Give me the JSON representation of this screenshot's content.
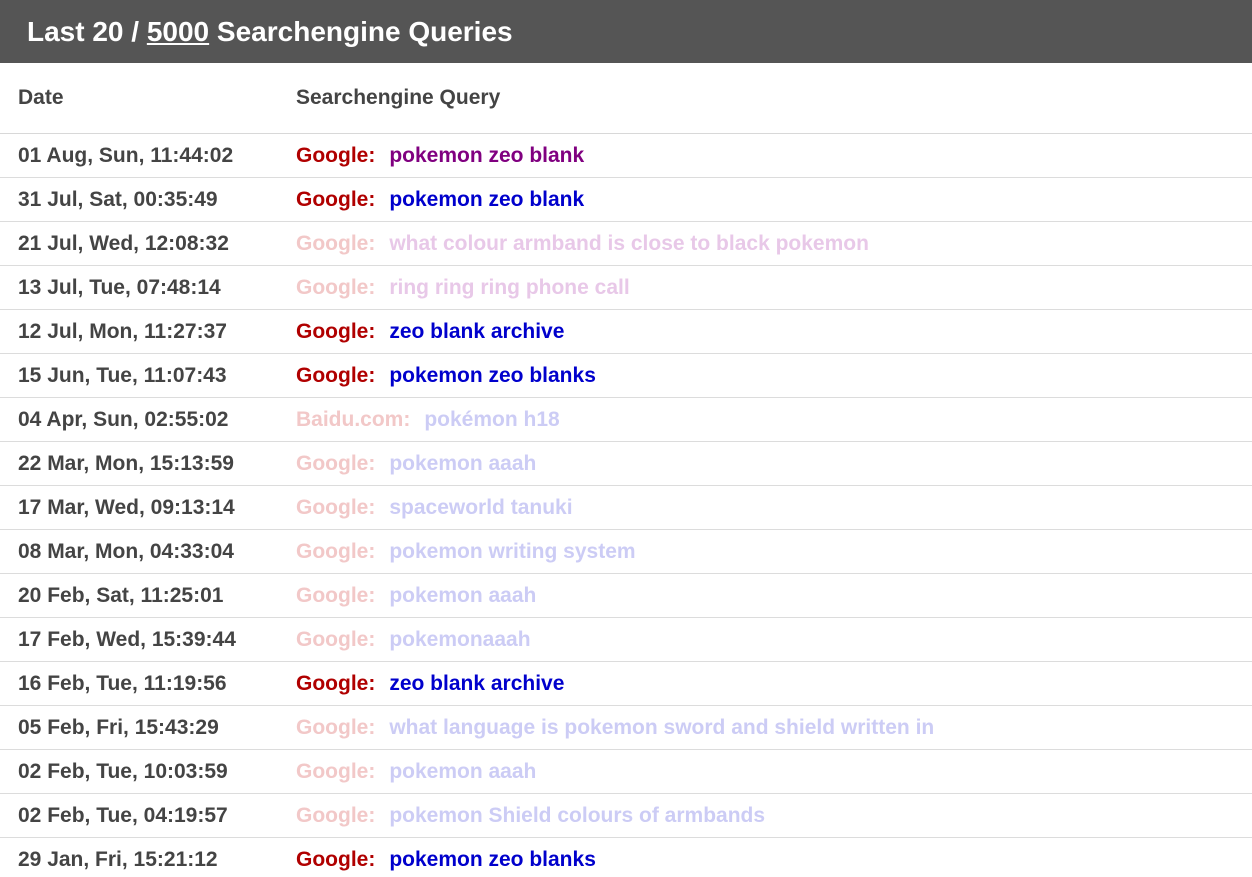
{
  "header": {
    "prefix": "Last 20 / ",
    "total": "5000",
    "suffix": " Searchengine Queries"
  },
  "columns": {
    "date": "Date",
    "query": "Searchengine Query"
  },
  "colors": {
    "header_bg": "#555555",
    "engine_active": "#b00000",
    "engine_faded": "#f2c8c8",
    "query_visited": "#800080",
    "query_active": "#0000cc",
    "query_faded_pink": "#e8c8e8",
    "query_faded_blue": "#ccccf5"
  },
  "rows": [
    {
      "date": "01 Aug, Sun, 11:44:02",
      "engine": "Google:",
      "query": "pokemon zeo blank",
      "engine_color": "#b00000",
      "query_color": "#800080"
    },
    {
      "date": "31 Jul, Sat, 00:35:49",
      "engine": "Google:",
      "query": "pokemon zeo blank",
      "engine_color": "#b00000",
      "query_color": "#0000cc"
    },
    {
      "date": "21 Jul, Wed, 12:08:32",
      "engine": "Google:",
      "query": "what colour armband is close to black pokemon",
      "engine_color": "#f2c8c8",
      "query_color": "#e8c8e8"
    },
    {
      "date": "13 Jul, Tue, 07:48:14",
      "engine": "Google:",
      "query": "ring ring ring phone call",
      "engine_color": "#f2c8c8",
      "query_color": "#e8c8e8"
    },
    {
      "date": "12 Jul, Mon, 11:27:37",
      "engine": "Google:",
      "query": "zeo blank archive",
      "engine_color": "#b00000",
      "query_color": "#0000cc"
    },
    {
      "date": "15 Jun, Tue, 11:07:43",
      "engine": "Google:",
      "query": "pokemon zeo blanks",
      "engine_color": "#b00000",
      "query_color": "#0000cc"
    },
    {
      "date": "04 Apr, Sun, 02:55:02",
      "engine": "Baidu.com:",
      "query": "pokémon h18",
      "engine_color": "#f2c8c8",
      "query_color": "#ccccf5"
    },
    {
      "date": "22 Mar, Mon, 15:13:59",
      "engine": "Google:",
      "query": "pokemon aaah",
      "engine_color": "#f2c8c8",
      "query_color": "#ccccf5"
    },
    {
      "date": "17 Mar, Wed, 09:13:14",
      "engine": "Google:",
      "query": "spaceworld tanuki",
      "engine_color": "#f2c8c8",
      "query_color": "#ccccf5"
    },
    {
      "date": "08 Mar, Mon, 04:33:04",
      "engine": "Google:",
      "query": "pokemon writing system",
      "engine_color": "#f2c8c8",
      "query_color": "#ccccf5"
    },
    {
      "date": "20 Feb, Sat, 11:25:01",
      "engine": "Google:",
      "query": "pokemon aaah",
      "engine_color": "#f2c8c8",
      "query_color": "#ccccf5"
    },
    {
      "date": "17 Feb, Wed, 15:39:44",
      "engine": "Google:",
      "query": "pokemonaaah",
      "engine_color": "#f2c8c8",
      "query_color": "#ccccf5"
    },
    {
      "date": "16 Feb, Tue, 11:19:56",
      "engine": "Google:",
      "query": "zeo blank archive",
      "engine_color": "#b00000",
      "query_color": "#0000cc"
    },
    {
      "date": "05 Feb, Fri, 15:43:29",
      "engine": "Google:",
      "query": "what language is pokemon sword and shield written in",
      "engine_color": "#f2c8c8",
      "query_color": "#ccccf5"
    },
    {
      "date": "02 Feb, Tue, 10:03:59",
      "engine": "Google:",
      "query": "pokemon aaah",
      "engine_color": "#f2c8c8",
      "query_color": "#ccccf5"
    },
    {
      "date": "02 Feb, Tue, 04:19:57",
      "engine": "Google:",
      "query": "pokemon Shield colours of armbands",
      "engine_color": "#f2c8c8",
      "query_color": "#ccccf5"
    },
    {
      "date": "29 Jan, Fri, 15:21:12",
      "engine": "Google:",
      "query": "pokemon zeo blanks",
      "engine_color": "#b00000",
      "query_color": "#0000cc"
    }
  ]
}
